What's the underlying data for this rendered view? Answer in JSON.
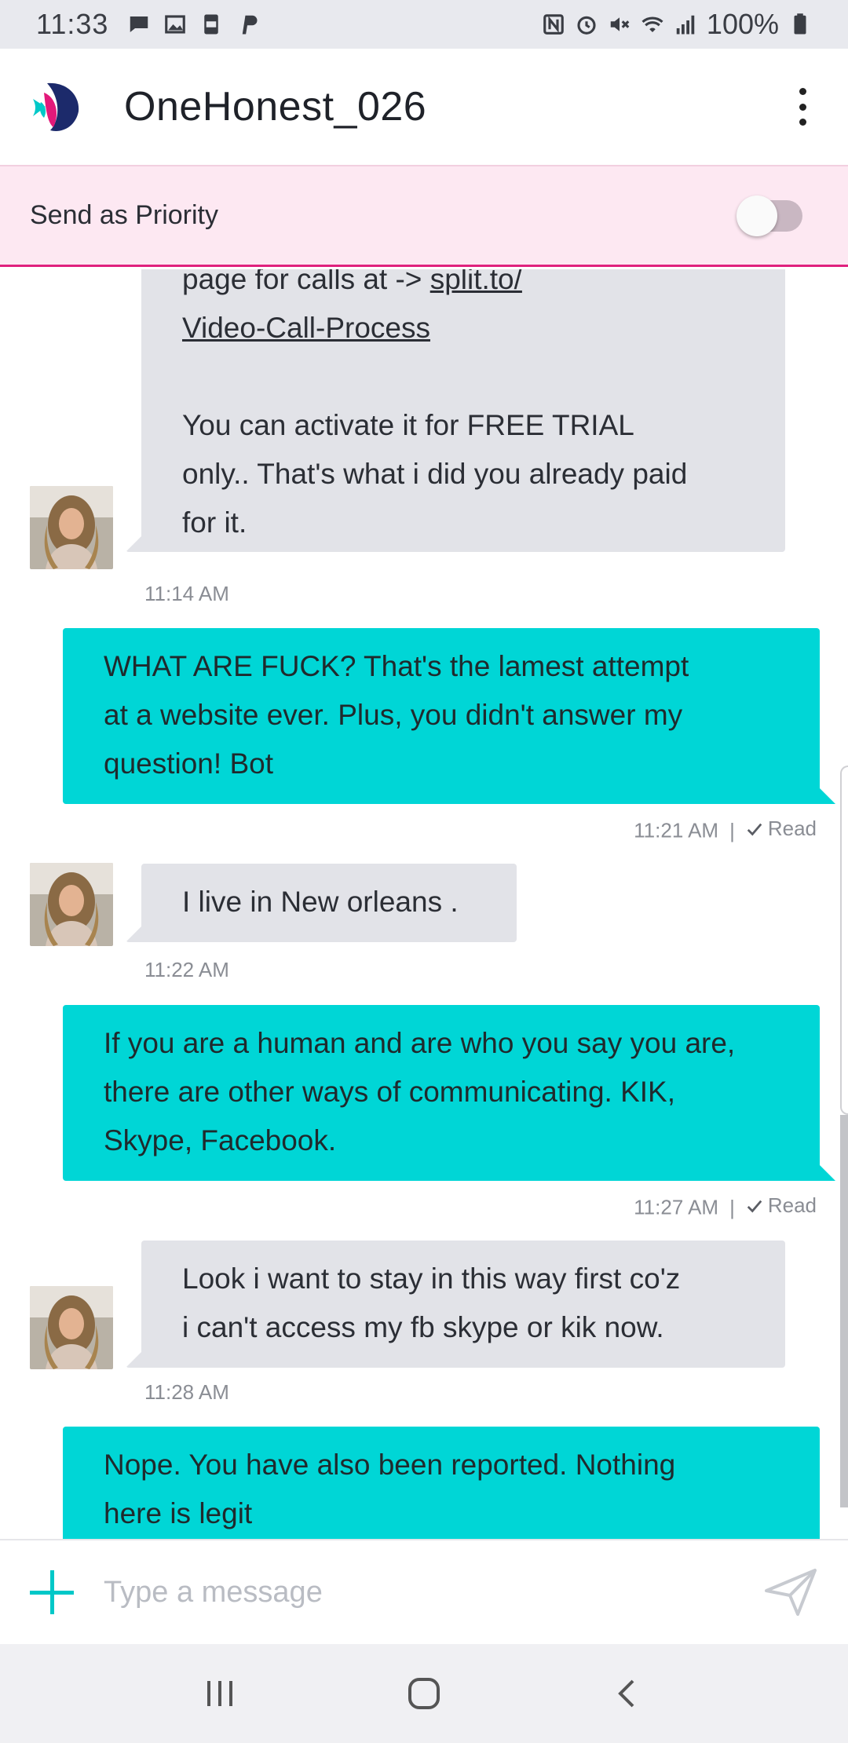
{
  "status_bar": {
    "time": "11:33",
    "battery": "100%"
  },
  "header": {
    "title": "OneHonest_026"
  },
  "priority": {
    "label": "Send as Priority",
    "enabled": false
  },
  "messages": [
    {
      "direction": "in",
      "lines": [
        "page for calls at -> ",
        "split.to/",
        "Video-Call-Process",
        "You can activate it for FREE TRIAL",
        "only.. That's what i did you already paid",
        "for it."
      ],
      "time": "11:14 AM"
    },
    {
      "direction": "out",
      "lines": [
        "WHAT ARE FUCK? That's the lamest attempt",
        "at a website ever. Plus, you didn't answer my",
        "question! Bot"
      ],
      "time": "11:21 AM",
      "status": "Read"
    },
    {
      "direction": "in",
      "lines": [
        "I live in New orleans ."
      ],
      "time": "11:22 AM"
    },
    {
      "direction": "out",
      "lines": [
        "If you are a human and are who you say you are,",
        "there are other ways of communicating. KIK,",
        "Skype, Facebook."
      ],
      "time": "11:27 AM",
      "status": "Read"
    },
    {
      "direction": "in",
      "lines": [
        "Look i want to stay in this way first co'z",
        "i can't access my fb skype or kik now."
      ],
      "time": "11:28 AM"
    },
    {
      "direction": "out",
      "lines": [
        "Nope. You have also been reported. Nothing",
        "here is legit"
      ]
    }
  ],
  "separator": "|",
  "composer": {
    "placeholder": "Type a message"
  },
  "colors": {
    "accent": "#00d6d6",
    "priority_bg": "#fde8f2",
    "priority_border": "#e0217e",
    "incoming_bubble": "#e2e3e8"
  },
  "icons": {
    "logo": "angelfish-logo-icon",
    "menu": "more-vert-icon",
    "add": "plus-icon",
    "send": "send-icon",
    "read": "check-icon"
  }
}
